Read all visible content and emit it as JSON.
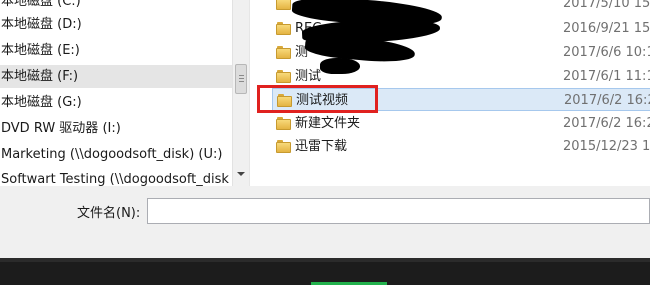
{
  "nav": {
    "items": [
      {
        "label": "本地磁盘 (C:)"
      },
      {
        "label": "本地磁盘 (D:)"
      },
      {
        "label": "本地磁盘 (E:)"
      },
      {
        "label": "本地磁盘 (F:)",
        "selected": true
      },
      {
        "label": "本地磁盘 (G:)"
      },
      {
        "label": "DVD RW 驱动器 (I:)"
      },
      {
        "label": "Marketing (\\\\dogoodsoft_disk) (U:)"
      },
      {
        "label": "Softwart Testing (\\\\dogoodsoft_disk"
      }
    ]
  },
  "files": {
    "rows": [
      {
        "name": "",
        "date": "2017/5/10 15"
      },
      {
        "name": "REC",
        "date": "2016/9/21 15"
      },
      {
        "name": "测",
        "date": "2017/6/6 10:1"
      },
      {
        "name": "测试",
        "date": "2017/6/1 11:1"
      },
      {
        "name": "测试视频",
        "date": "2017/6/2 16:2",
        "selected": true
      },
      {
        "name": "新建文件夹",
        "date": "2017/6/2 16:2"
      },
      {
        "name": "迅雷下载",
        "date": "2015/12/23 1"
      }
    ]
  },
  "filename": {
    "label": "文件名(N):",
    "value": ""
  },
  "colors": {
    "highlight": "#e0211f",
    "selection": "#dbe9f7",
    "taskbar": "#1c1c1c",
    "accent": "#22b14c"
  }
}
